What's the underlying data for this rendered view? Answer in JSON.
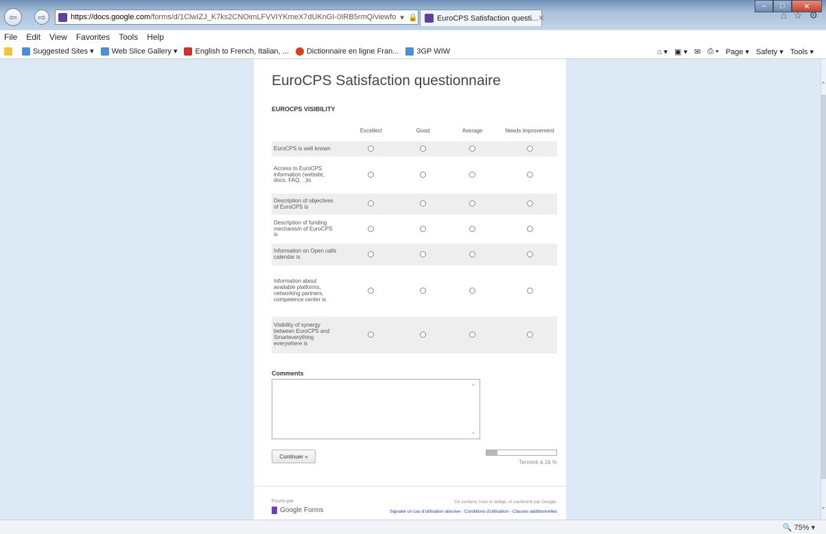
{
  "browser": {
    "url_host": "https://docs.google.com",
    "url_path": "/forms/d/1ClwIZJ_K7ks2CNOimLFVVIYKmeX7dUKnGI-0IRB5rmQ/viewfo",
    "tab_title": "EuroCPS Satisfaction questi...",
    "menu": [
      "File",
      "Edit",
      "View",
      "Favorites",
      "Tools",
      "Help"
    ],
    "favorites": [
      "Suggested Sites ▾",
      "Web Slice Gallery ▾",
      "English to French, Italian, ...",
      "Dictionnaire en ligne Fran...",
      "3GP  WIW"
    ],
    "command_bar": [
      "Page ▾",
      "Safety ▾",
      "Tools ▾"
    ],
    "zoom": "75%"
  },
  "form": {
    "title": "EuroCPS Satisfaction questionnaire",
    "section_title": "EUROCPS VISIBILITY",
    "columns": [
      "Excellect",
      "Good",
      "Average",
      "Needs improvement"
    ],
    "rows": [
      "EuroCPS is well known",
      "Access to EuroCPS information (website, docs, FAQ, ..)is",
      "Description of objectives of EuroCPS is",
      "Description of funding mechanism of EuroCPS is",
      "Information on Open calls calendar is",
      "Information about available platforms, networking partners, competence center is",
      "Visibility of synergy between EuroCPS and Smarteverything everywhere is"
    ],
    "comments_label": "Comments",
    "comments_value": "",
    "continue_label": "Continuer »",
    "progress_fraction": 0.16,
    "progress_text": "Terminé à 16 %"
  },
  "footer": {
    "powered_by": "Fourni par",
    "brand": "Google Forms",
    "disclaimer": "Ce contenu n'est ni rédigé, ni cautionné par Google.",
    "links": "Signaler un cas d'utilisation abusive - Conditions d'utilisation - Clauses additionnelles"
  }
}
